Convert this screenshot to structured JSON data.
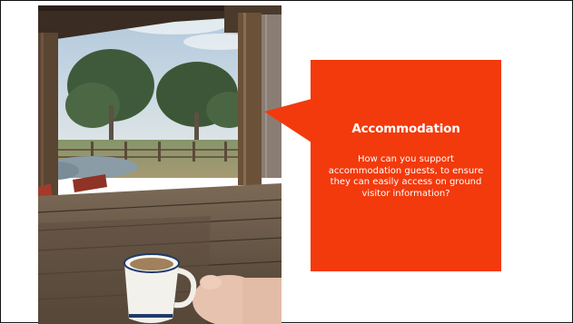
{
  "slide": {
    "image_subject": "veranda-enamel-mug-photo",
    "callout": {
      "title": "Accommodation",
      "body": "How can you support accommodation guests, to ensure they can easily access on ground visitor information?",
      "background_color": "#f23a0c",
      "text_color": "#ffffff"
    },
    "border_color": "#111111"
  }
}
